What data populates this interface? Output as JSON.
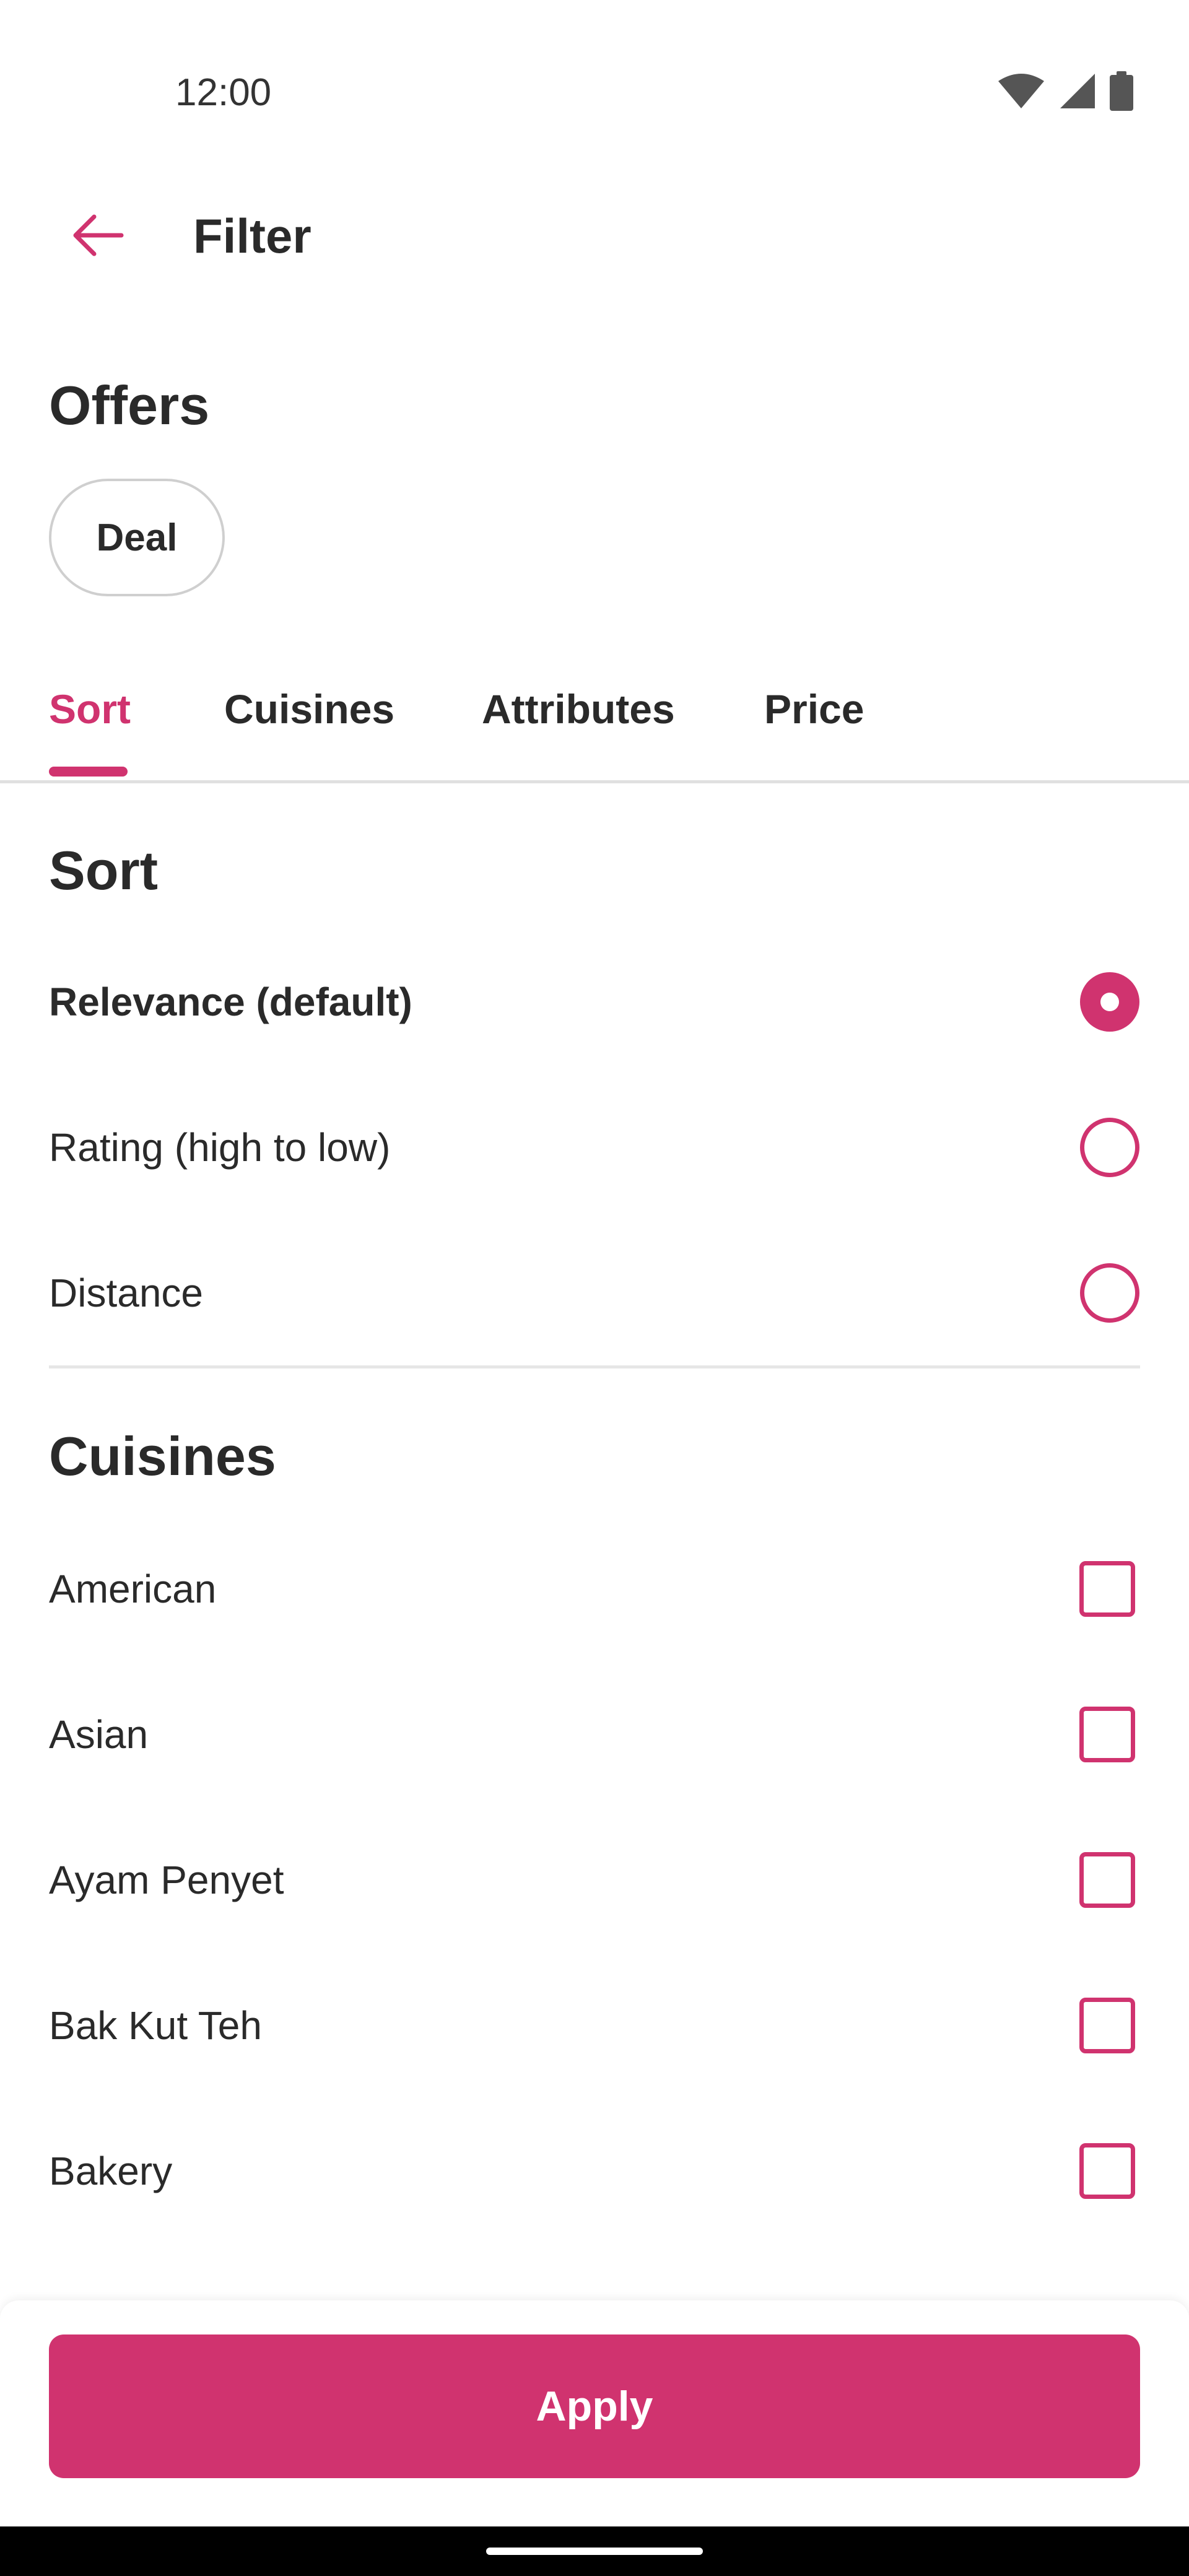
{
  "status_bar": {
    "time": "12:00",
    "icons": [
      "wifi-icon",
      "cellular-signal-icon",
      "battery-icon"
    ]
  },
  "app_bar": {
    "title": "Filter",
    "back_icon": "arrow-back-icon"
  },
  "offers": {
    "heading": "Offers",
    "chips": [
      {
        "label": "Deal",
        "selected": false
      }
    ]
  },
  "tabs": [
    {
      "label": "Sort",
      "active": true
    },
    {
      "label": "Cuisines",
      "active": false
    },
    {
      "label": "Attributes",
      "active": false
    },
    {
      "label": "Price",
      "active": false
    }
  ],
  "sort": {
    "heading": "Sort",
    "options": [
      {
        "label": "Relevance (default)",
        "selected": true
      },
      {
        "label": "Rating (high to low)",
        "selected": false
      },
      {
        "label": "Distance",
        "selected": false
      }
    ]
  },
  "cuisines": {
    "heading": "Cuisines",
    "options": [
      {
        "label": "American",
        "checked": false
      },
      {
        "label": "Asian",
        "checked": false
      },
      {
        "label": "Ayam Penyet",
        "checked": false
      },
      {
        "label": "Bak Kut Teh",
        "checked": false
      },
      {
        "label": "Bakery",
        "checked": false
      }
    ]
  },
  "apply_button": {
    "label": "Apply"
  },
  "colors": {
    "accent": "#d0336f",
    "text": "#2a2a2a",
    "divider": "#e0e0e0"
  }
}
